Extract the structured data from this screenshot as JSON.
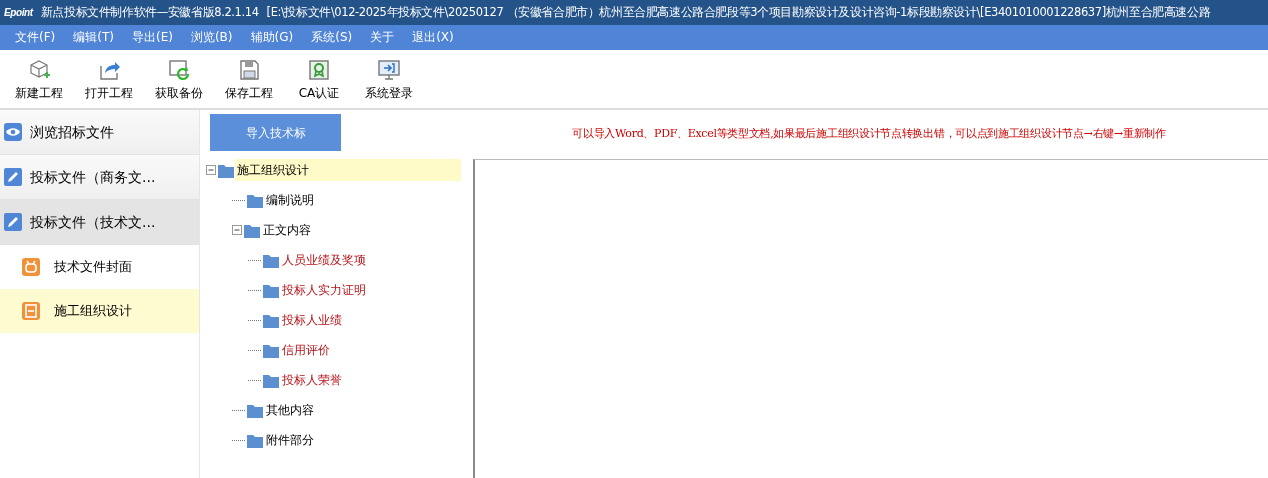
{
  "window": {
    "logo": "Epoint",
    "title": "新点投标文件制作软件—安徽省版8.2.1.14",
    "path": "[E:\\投标文件\\012-2025年投标文件\\20250127 （安徽省合肥市）杭州至合肥高速公路合肥段等3个项目勘察设计及设计咨询-1标段勘察设计\\[E3401010001228637]杭州至合肥高速公路"
  },
  "menu": [
    "文件(F)",
    "编辑(T)",
    "导出(E)",
    "浏览(B)",
    "辅助(G)",
    "系统(S)",
    "关于",
    "退出(X)"
  ],
  "toolbar": [
    {
      "kind": "new",
      "label": "新建工程"
    },
    {
      "kind": "open",
      "label": "打开工程"
    },
    {
      "kind": "backup",
      "label": "获取备份"
    },
    {
      "kind": "save",
      "label": "保存工程"
    },
    {
      "kind": "ca",
      "label": "CA认证"
    },
    {
      "kind": "login",
      "label": "系统登录"
    }
  ],
  "sidebar": {
    "items": [
      {
        "kind": "section",
        "label": "浏览招标文件",
        "selected": false
      },
      {
        "kind": "section",
        "label": "投标文件（商务文...",
        "selected": false
      },
      {
        "kind": "section",
        "label": "投标文件（技术文...",
        "selected": true
      },
      {
        "kind": "page",
        "label": "技术文件封面",
        "selected": false
      },
      {
        "kind": "page",
        "label": "施工组织设计",
        "selected": true
      }
    ]
  },
  "import_button": "导入技术标",
  "hint": "可以导入Word、PDF、Excel等类型文档,如果最后施工组织设计节点转换出错，可以点到施工组织设计节点→右键→重新制作",
  "tree": [
    {
      "label": "施工组织设计",
      "expanded": true,
      "selected": true,
      "flagged": false,
      "children": [
        {
          "label": "编制说明",
          "selected": false,
          "flagged": false
        },
        {
          "label": "正文内容",
          "expanded": true,
          "selected": false,
          "flagged": false,
          "children": [
            {
              "label": "人员业绩及奖项",
              "selected": false,
              "flagged": true
            },
            {
              "label": "投标人实力证明",
              "selected": false,
              "flagged": true
            },
            {
              "label": "投标人业绩",
              "selected": false,
              "flagged": true
            },
            {
              "label": "信用评价",
              "selected": false,
              "flagged": true
            },
            {
              "label": "投标人荣誉",
              "selected": false,
              "flagged": true
            }
          ]
        },
        {
          "label": "其他内容",
          "selected": false,
          "flagged": false
        },
        {
          "label": "附件部分",
          "selected": false,
          "flagged": false
        }
      ]
    }
  ]
}
